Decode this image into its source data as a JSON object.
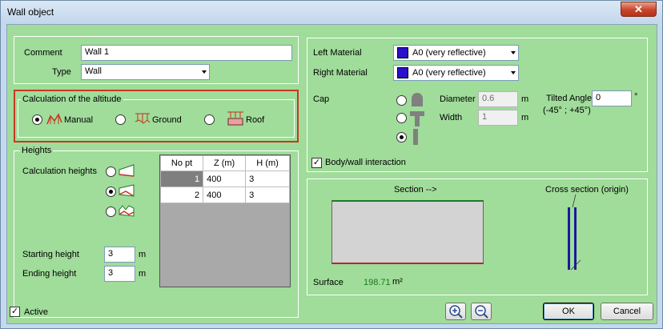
{
  "window": {
    "title": "Wall object",
    "close_glyph": "✕"
  },
  "general": {
    "comment_label": "Comment",
    "comment_value": "Wall 1",
    "type_label": "Type",
    "type_value": "Wall"
  },
  "altitude": {
    "group_label": "Calculation of the altitude",
    "options": [
      {
        "label": "Manual",
        "selected": true,
        "icon": "manual-altitude-icon"
      },
      {
        "label": "Ground",
        "selected": false,
        "icon": "ground-altitude-icon"
      },
      {
        "label": "Roof",
        "selected": false,
        "icon": "roof-altitude-icon"
      }
    ]
  },
  "heights": {
    "group_label": "Heights",
    "calc_label": "Calculation heights",
    "calc_options": [
      {
        "selected": false,
        "icon": "flat-top-wall-icon"
      },
      {
        "selected": true,
        "icon": "sloped-top-wall-icon"
      },
      {
        "selected": false,
        "icon": "jagged-top-wall-icon"
      }
    ],
    "starting_label": "Starting height",
    "starting_value": "3",
    "starting_unit": "m",
    "ending_label": "Ending height",
    "ending_value": "3",
    "ending_unit": "m",
    "table": {
      "columns": [
        "No pt",
        "Z (m)",
        "H (m)"
      ],
      "rows": [
        {
          "no": "1",
          "z": "400",
          "h": "3",
          "selected": true
        },
        {
          "no": "2",
          "z": "400",
          "h": "3",
          "selected": false
        }
      ]
    }
  },
  "materials": {
    "left_label": "Left Material",
    "left_value": "A0 (very reflective)",
    "right_label": "Right Material",
    "right_value": "A0 (very reflective)",
    "swatch_color": "#2a10c8"
  },
  "cap": {
    "label": "Cap",
    "options": [
      {
        "selected": false,
        "icon": "round-cap-icon"
      },
      {
        "selected": false,
        "icon": "t-cap-icon"
      },
      {
        "selected": true,
        "icon": "no-cap-icon"
      }
    ],
    "diameter_label": "Diameter",
    "diameter_value": "0.6",
    "diameter_unit": "m",
    "width_label": "Width",
    "width_value": "1",
    "width_unit": "m",
    "tilted_label": "Tilted Angle",
    "tilted_value": "0",
    "tilted_unit": "°",
    "tilted_range": "(-45° ; +45°)"
  },
  "interaction": {
    "label": "Body/wall interaction",
    "checked": true
  },
  "preview": {
    "section_label": "Section  -->",
    "cross_label": "Cross section (origin)",
    "surface_label": "Surface",
    "surface_value": "198.71",
    "surface_unit": "m²",
    "surface_value_color": "#1a7a1a"
  },
  "footer": {
    "active_label": "Active",
    "active_checked": true,
    "ok_label": "OK",
    "cancel_label": "Cancel"
  }
}
